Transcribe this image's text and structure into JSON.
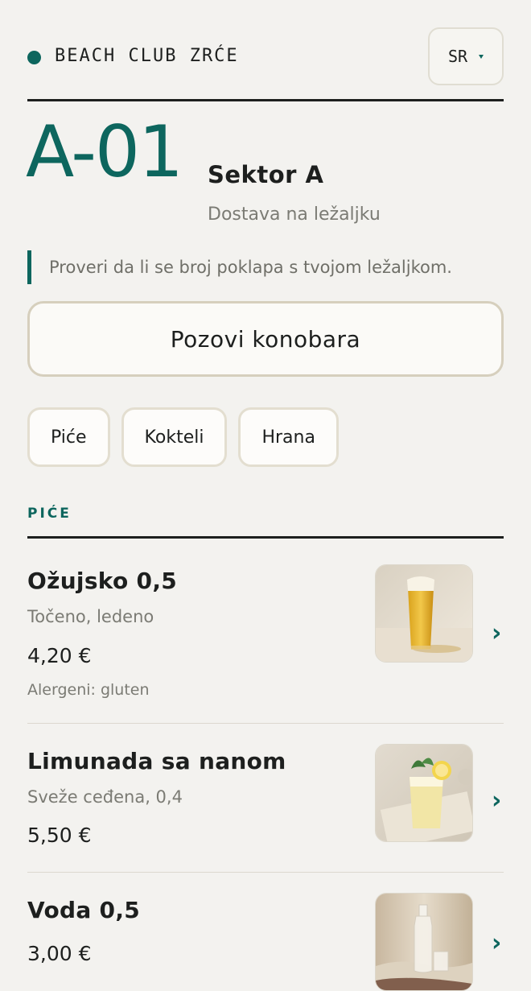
{
  "header": {
    "brand": "BEACH CLUB ZRĆE",
    "language": "SR"
  },
  "sunbed": {
    "code": "A-01",
    "sector": "Sektor A",
    "delivery": "Dostava na ležaljku",
    "notice": "Proveri da li se broj poklapa s tvojom ležaljkom."
  },
  "call_button": "Pozovi konobara",
  "tabs": [
    "Piće",
    "Kokteli",
    "Hrana"
  ],
  "section": {
    "title": "PIĆE"
  },
  "items": [
    {
      "name": "Ožujsko 0,5",
      "description": "Točeno, ledeno",
      "price": "4,20 €",
      "allergens": "Alergeni: gluten",
      "photo": "beer-glass"
    },
    {
      "name": "Limunada sa nanom",
      "description": "Sveže ceđena, 0,4",
      "price": "5,50 €",
      "photo": "lemonade-glass"
    },
    {
      "name": "Voda 0,5",
      "price": "3,00 €",
      "photo": "water-bottle"
    }
  ],
  "colors": {
    "accent": "#0d665e",
    "background": "#f3f2ef",
    "text": "#1d1f1e",
    "muted": "#7b7b74",
    "border": "#d6cfbd"
  }
}
